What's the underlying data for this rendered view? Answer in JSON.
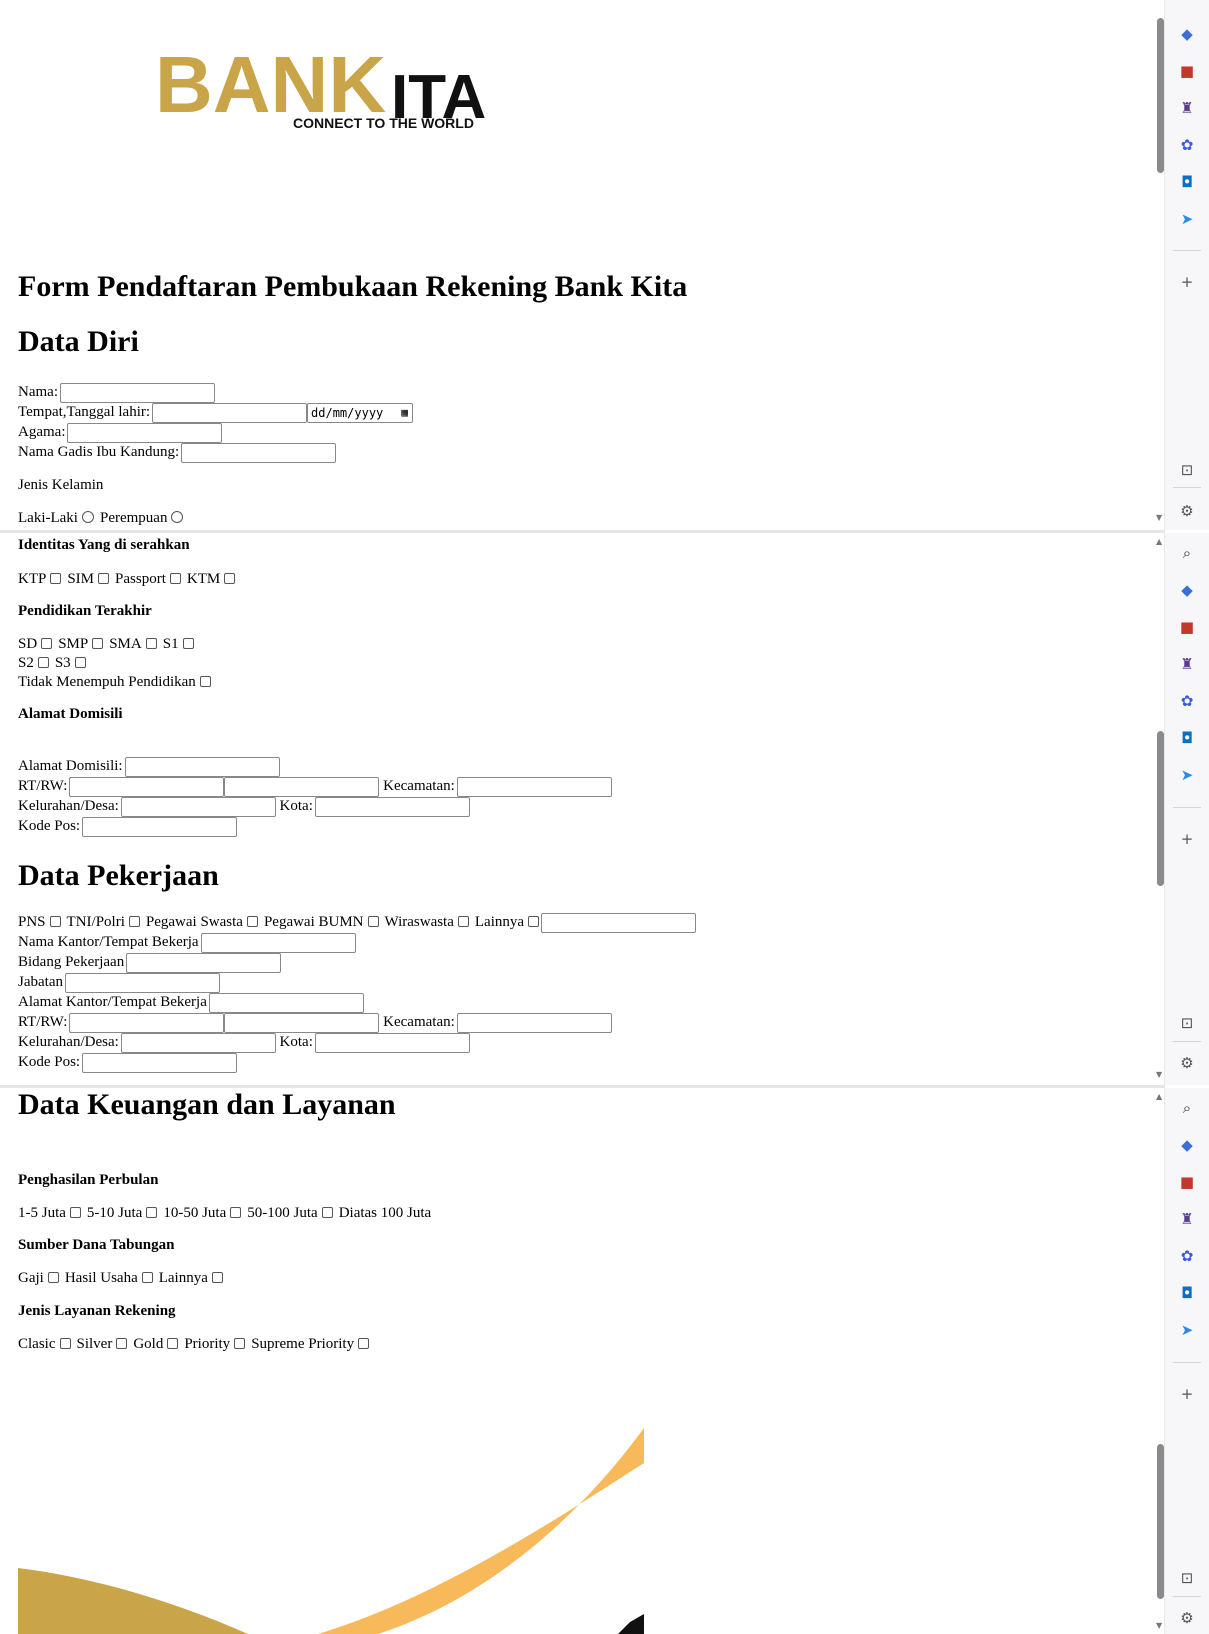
{
  "logo": {
    "brand_left": "BANK",
    "brand_right": "ITA",
    "tagline": "CONNECT TO THE WORLD",
    "gold": "#c9a448",
    "dark": "#111111"
  },
  "page_title": "Form Pendaftaran Pembukaan Rekening Bank Kita",
  "data_diri": {
    "heading": "Data Diri",
    "nama": "Nama:",
    "tempat_tanggal_lahir": "Tempat,Tanggal lahir:",
    "date_placeholder": "dd/mm/yyyy",
    "agama": "Agama:",
    "nama_gadis_ibu": "Nama Gadis Ibu Kandung:",
    "jenis_kelamin": "Jenis Kelamin",
    "gender_options": [
      "Laki-Laki",
      "Perempuan"
    ]
  },
  "identitas": {
    "heading": "Identitas Yang di serahkan",
    "options": [
      "KTP",
      "SIM",
      "Passport",
      "KTM"
    ]
  },
  "pendidikan": {
    "heading": "Pendidikan Terakhir",
    "options_row1": [
      "SD",
      "SMP",
      "SMA",
      "S1"
    ],
    "options_row2": [
      "S2",
      "S3"
    ],
    "option_row3": "Tidak Menempuh Pendidikan"
  },
  "alamat": {
    "heading": "Alamat Domisili",
    "alamat_domisili": "Alamat Domisili:",
    "rt_rw": "RT/RW:",
    "kecamatan": "Kecamatan:",
    "kelurahan": "Kelurahan/Desa:",
    "kota": "Kota:",
    "kode_pos": "Kode Pos:"
  },
  "pekerjaan": {
    "heading": "Data Pekerjaan",
    "options": [
      "PNS",
      "TNI/Polri",
      "Pegawai Swasta",
      "Pegawai BUMN",
      "Wiraswasta",
      "Lainnya"
    ],
    "nama_kantor": "Nama Kantor/Tempat Bekerja",
    "bidang": "Bidang Pekerjaan",
    "jabatan": "Jabatan",
    "alamat_kantor": "Alamat Kantor/Tempat Bekerja",
    "rt_rw": "RT/RW:",
    "kecamatan": "Kecamatan:",
    "kelurahan": "Kelurahan/Desa:",
    "kota": "Kota:",
    "kode_pos": "Kode Pos:"
  },
  "keuangan": {
    "heading": "Data Keuangan dan Layanan",
    "penghasilan_heading": "Penghasilan Perbulan",
    "penghasilan_options": [
      "1-5 Juta",
      "5-10 Juta",
      "10-50 Juta",
      "50-100 Juta",
      "Diatas 100 Juta"
    ],
    "sumber_heading": "Sumber Dana Tabungan",
    "sumber_options": [
      "Gaji",
      "Hasil Usaha",
      "Lainnya"
    ],
    "layanan_heading": "Jenis Layanan Rekening",
    "layanan_options": [
      "Clasic",
      "Silver",
      "Gold",
      "Priority",
      "Supreme Priority"
    ]
  },
  "colors": {
    "swoosh_orange": "#f8b95a",
    "swoosh_gold": "#c9a448",
    "swoosh_dark": "#111111"
  }
}
